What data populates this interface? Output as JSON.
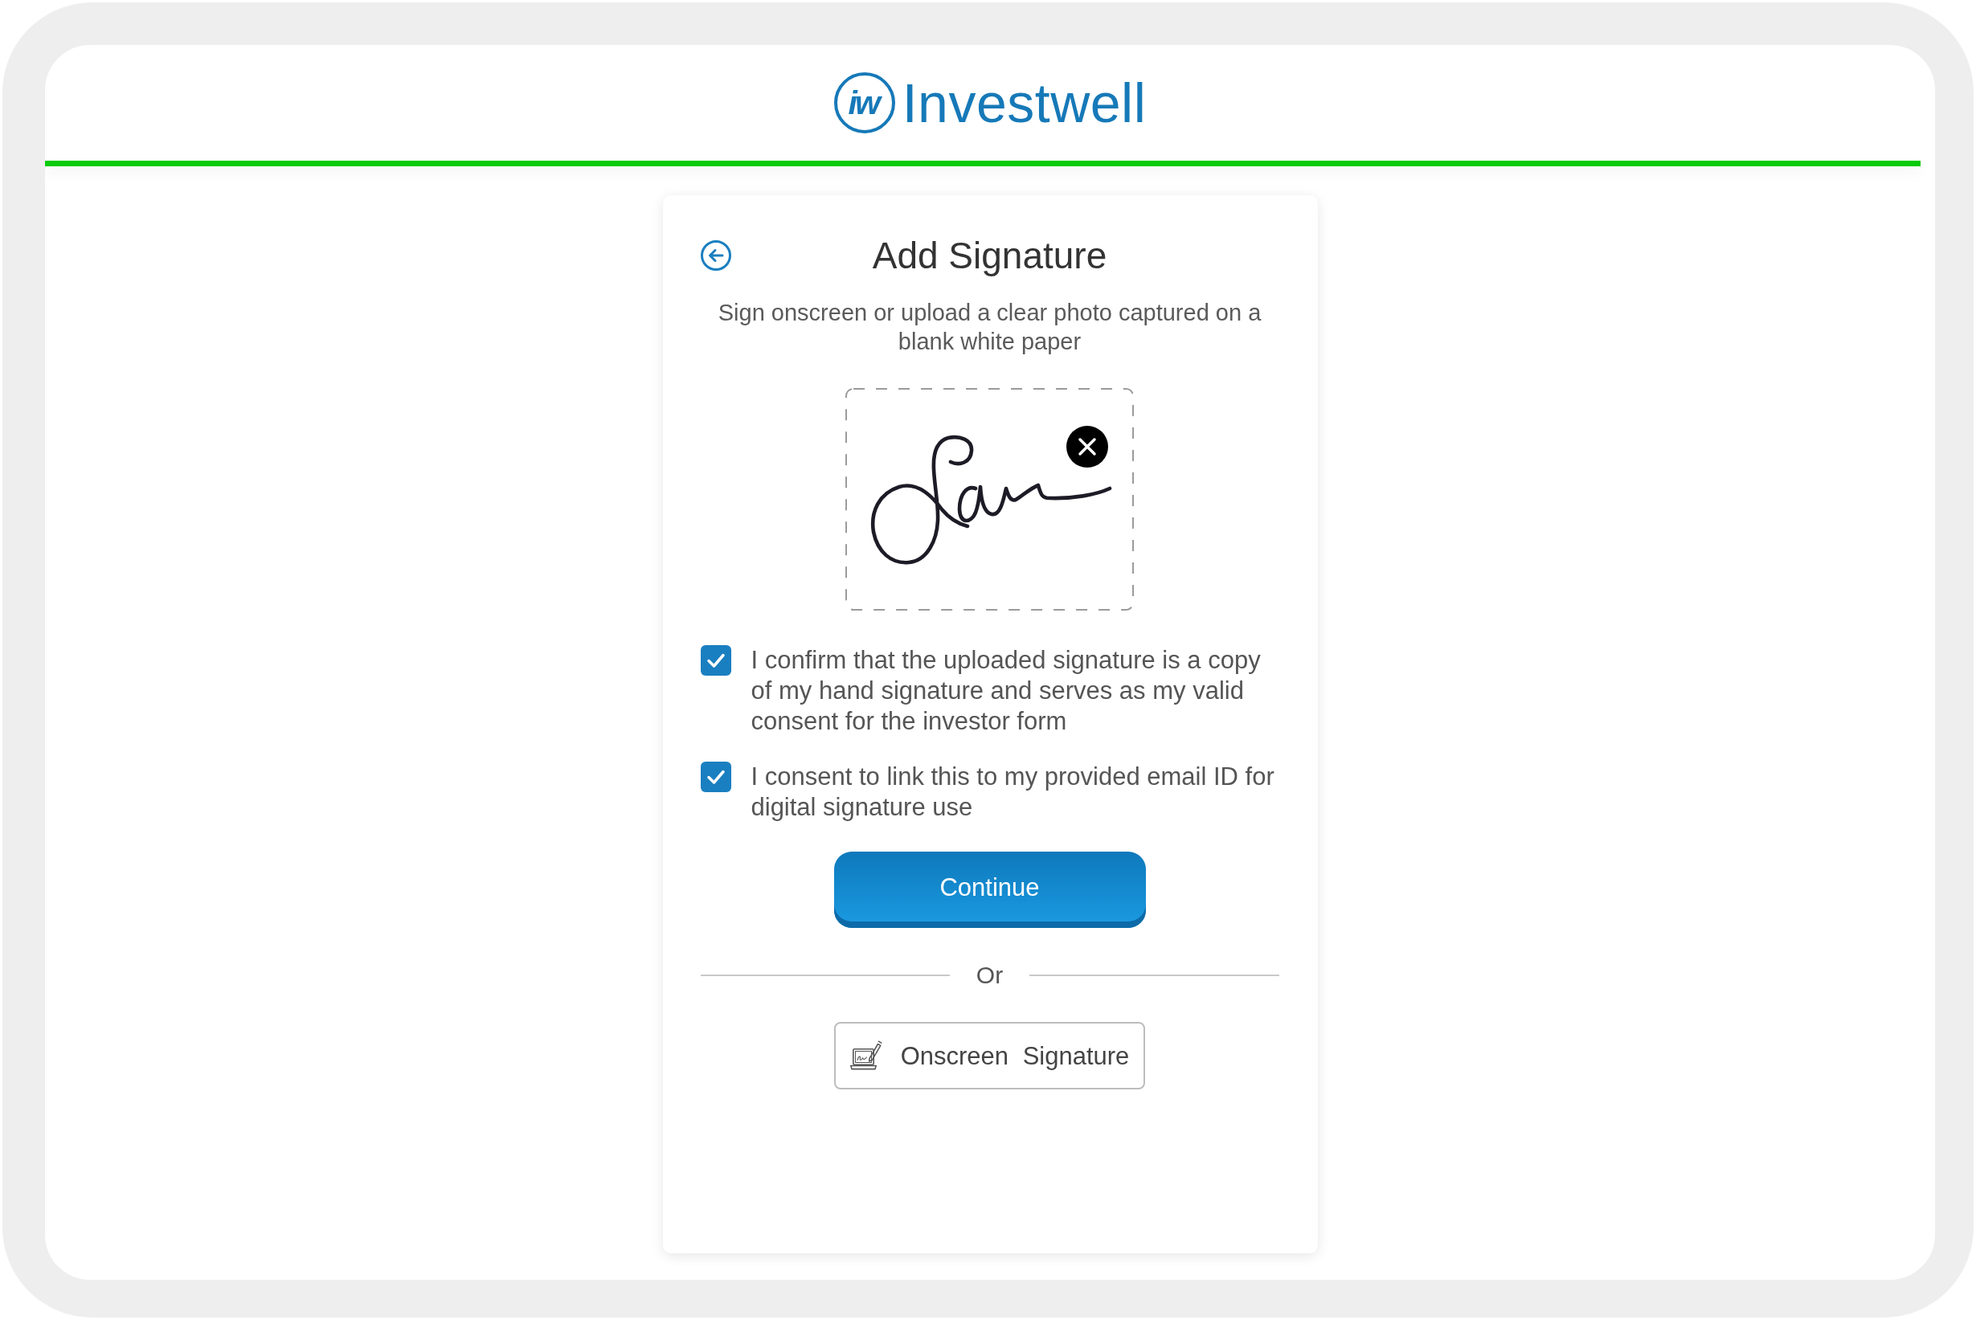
{
  "header": {
    "logo": {
      "mark": "iw",
      "wordmark": "Investwell"
    }
  },
  "card": {
    "title": "Add Signature",
    "subtitle": "Sign onscreen or upload a clear photo captured on a blank white paper",
    "consents": [
      {
        "label": "I confirm that the uploaded signature is a copy of my hand signature and serves as my valid consent for the investor form",
        "checked": true
      },
      {
        "label": "I consent to link this to my provided email ID for digital signature use",
        "checked": true
      }
    ],
    "continue_button": "Continue",
    "divider_label": "Or",
    "onscreen_button": "Onscreen Signature"
  }
}
